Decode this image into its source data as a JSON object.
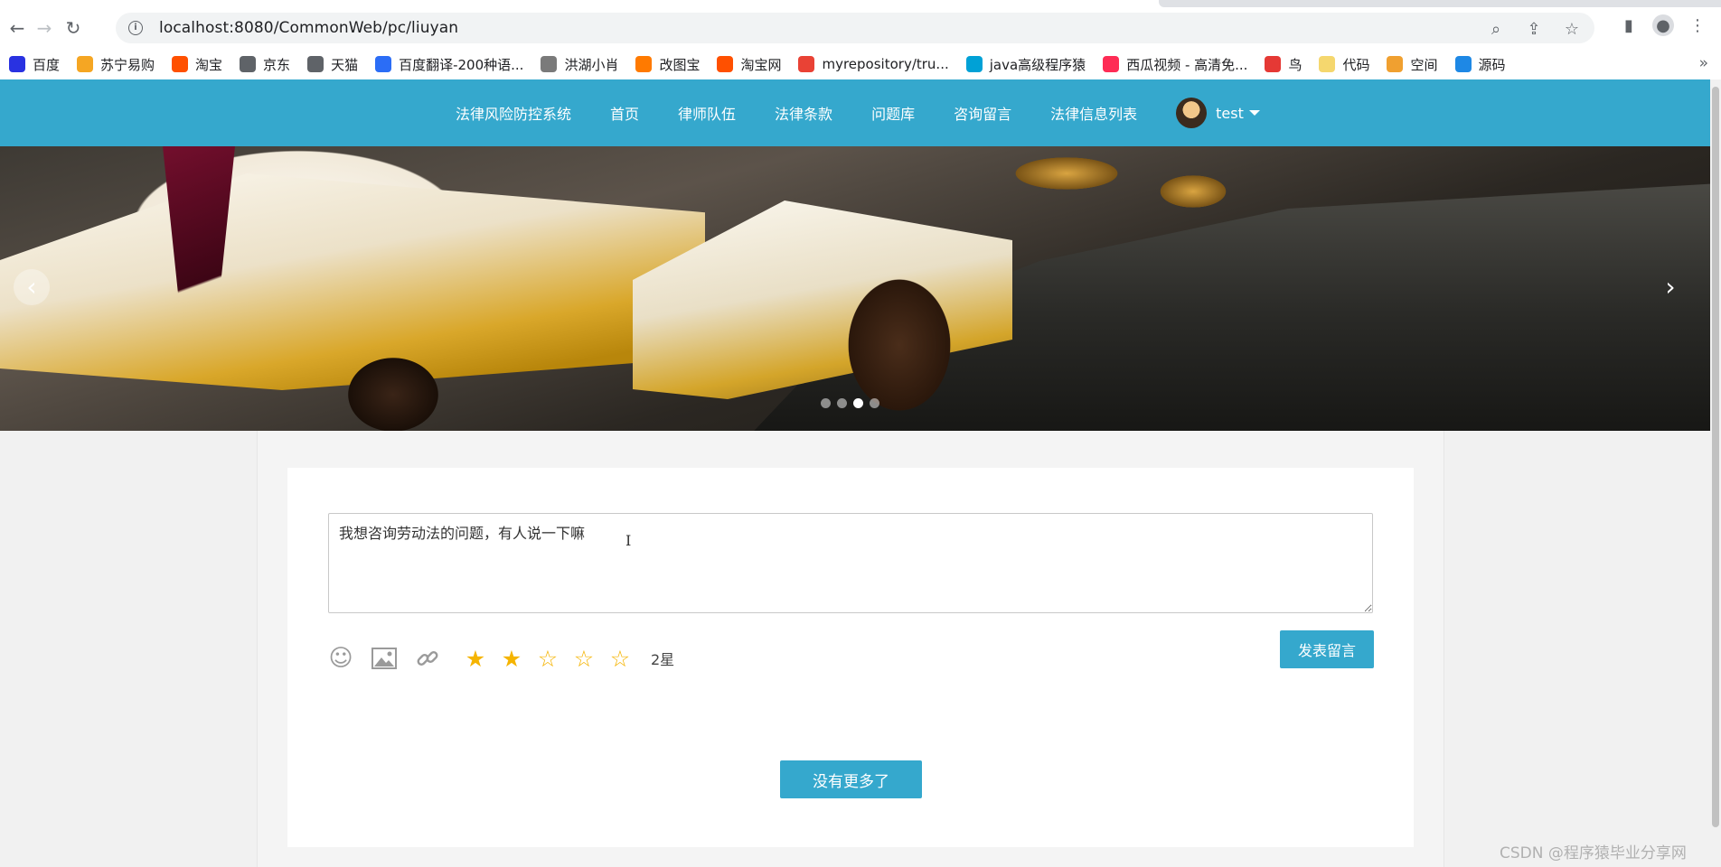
{
  "browser": {
    "url": "localhost:8080/CommonWeb/pc/liuyan",
    "bookmarks": [
      {
        "label": "百度",
        "color": "#2932e1"
      },
      {
        "label": "苏宁易购",
        "color": "#f5a623"
      },
      {
        "label": "淘宝",
        "color": "#ff5000"
      },
      {
        "label": "京东",
        "color": "#5f6368"
      },
      {
        "label": "天猫",
        "color": "#5f6368"
      },
      {
        "label": "百度翻译-200种语...",
        "color": "#2b6df6"
      },
      {
        "label": "洪湖小肖",
        "color": "#7a7a7a"
      },
      {
        "label": "改图宝",
        "color": "#ff7a00"
      },
      {
        "label": "淘宝网",
        "color": "#ff5000"
      },
      {
        "label": "myrepository/tru...",
        "color": "#e94235"
      },
      {
        "label": "java高级程序猿",
        "color": "#00a1d6"
      },
      {
        "label": "西瓜视频 - 高清免...",
        "color": "#fe2c55"
      },
      {
        "label": "鸟",
        "color": "#e53935"
      },
      {
        "label": "代码",
        "color": "#f5d76e"
      },
      {
        "label": "空间",
        "color": "#f0a030"
      },
      {
        "label": "源码",
        "color": "#1e88e5"
      }
    ],
    "more_label": "»"
  },
  "nav": {
    "links": [
      "法律风险防控系统",
      "首页",
      "律师队伍",
      "法律条款",
      "问题库",
      "咨询留言",
      "法律信息列表"
    ],
    "username": "test"
  },
  "banner": {
    "prev_label": "‹",
    "next_label": "›",
    "slide_count": 4,
    "active_slide": 3
  },
  "form": {
    "message_text": "我想咨询劳动法的问题，有人说一下嘛",
    "rating": 2,
    "rating_max": 5,
    "rating_text": "2星",
    "submit_label": "发表留言"
  },
  "list": {
    "no_more_label": "没有更多了"
  },
  "watermark": "CSDN @程序猿毕业分享网",
  "colors": {
    "brand": "#35a8cd",
    "star": "#f5b400"
  }
}
